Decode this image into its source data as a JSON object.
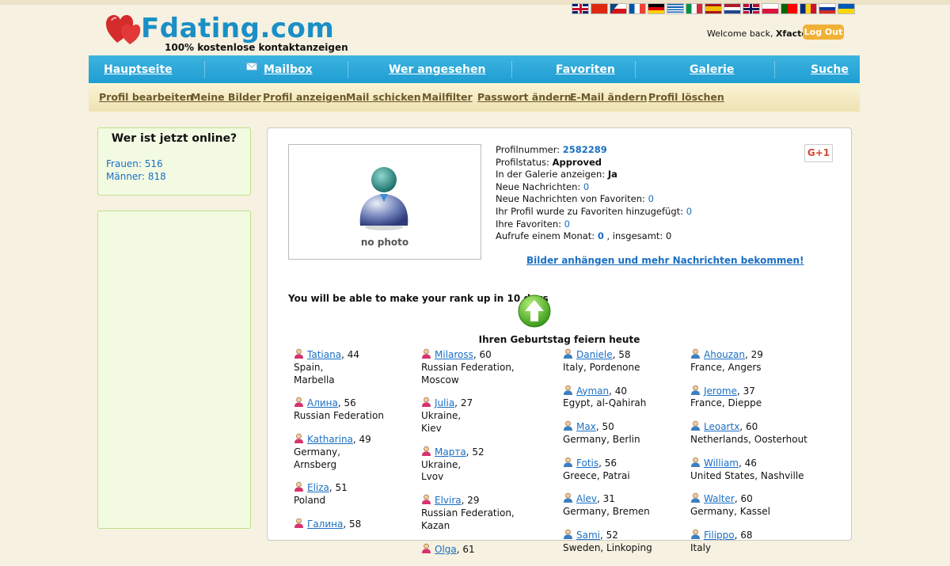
{
  "header": {
    "site_name": "Fdating.com",
    "tagline": "100% kostenlose kontaktanzeigen",
    "welcome_prefix": "Welcome back, ",
    "username": "Xfactor",
    "welcome_suffix": "!",
    "logout_label": "Log Out"
  },
  "languages": [
    "en",
    "zh",
    "cz",
    "fr",
    "de",
    "gr",
    "it",
    "es",
    "nl",
    "no",
    "pl",
    "pt",
    "ro",
    "ru",
    "ua"
  ],
  "main_nav": [
    "Hauptseite",
    "Mailbox",
    "Wer angesehen",
    "Favoriten",
    "Galerie",
    "Suche"
  ],
  "sub_nav": [
    "Profil bearbeiten",
    "Meine Bilder",
    "Profil anzeigen",
    "Mail schicken",
    "Mailfilter",
    "Passwort ändern",
    "E-Mail ändern",
    "Profil löschen"
  ],
  "online": {
    "title": "Wer ist jetzt online?",
    "women_label": "Frauen: 516",
    "men_label": "Männer: 818"
  },
  "profile": {
    "no_photo": "no photo",
    "number_label": "Profilnummer: ",
    "number": "2582289",
    "status_label": "Profilstatus: ",
    "status": "Approved",
    "gallery_label": "In der Galerie anzeigen: ",
    "gallery": "Ja",
    "new_messages_label": "Neue Nachrichten: ",
    "new_messages": "0",
    "fav_messages_label": "Neue Nachrichten von Favoriten: ",
    "fav_messages": "0",
    "added_label": "Ihr Profil wurde zu Favoriten hinzugefügt: ",
    "added": "0",
    "favorites_label": "Ihre Favoriten: ",
    "favorites": "0",
    "views_label": "Aufrufe einem Monat: ",
    "views_month": "0",
    "views_total_label": " , insgesamt: ",
    "views_total": "0",
    "gplus": "G+1",
    "attach_link": "Bilder anhängen und mehr Nachrichten bekommen!"
  },
  "rank_text": "You will be able to make your rank up in 10 days",
  "birthday_title": "Ihren Geburtstag feiern heute",
  "birthday_columns": [
    [
      {
        "name": "Tatiana",
        "age": "44",
        "gender": "female",
        "loc1": "Spain,",
        "loc2": "Marbella"
      },
      {
        "name": "Алина",
        "age": "56",
        "gender": "female",
        "loc1": "Russian Federation",
        "loc2": ""
      },
      {
        "name": "Katharina",
        "age": "49",
        "gender": "female",
        "loc1": "Germany,",
        "loc2": "Arnsberg"
      },
      {
        "name": "Eliza",
        "age": "51",
        "gender": "female",
        "loc1": "Poland",
        "loc2": ""
      },
      {
        "name": "Галина",
        "age": "58",
        "gender": "female",
        "loc1": "",
        "loc2": ""
      }
    ],
    [
      {
        "name": "Milaross",
        "age": "60",
        "gender": "female",
        "loc1": "Russian Federation,",
        "loc2": "Moscow"
      },
      {
        "name": "Julia",
        "age": "27",
        "gender": "female",
        "loc1": "Ukraine,",
        "loc2": "Kiev"
      },
      {
        "name": "Марта",
        "age": "52",
        "gender": "female",
        "loc1": "Ukraine,",
        "loc2": "Lvov"
      },
      {
        "name": "Elvira",
        "age": "29",
        "gender": "female",
        "loc1": "Russian Federation,",
        "loc2": "Kazan"
      },
      {
        "name": "Olga",
        "age": "61",
        "gender": "female",
        "loc1": "",
        "loc2": ""
      }
    ],
    [
      {
        "name": "Daniele",
        "age": "58",
        "gender": "male",
        "loc1": "Italy, Pordenone",
        "loc2": ""
      },
      {
        "name": "Ayman",
        "age": "40",
        "gender": "male",
        "loc1": "Egypt, al-Qahirah",
        "loc2": ""
      },
      {
        "name": "Max",
        "age": "50",
        "gender": "male",
        "loc1": "Germany, Berlin",
        "loc2": ""
      },
      {
        "name": "Fotis",
        "age": "56",
        "gender": "male",
        "loc1": "Greece, Patrai",
        "loc2": ""
      },
      {
        "name": "Alev",
        "age": "31",
        "gender": "male",
        "loc1": "Germany, Bremen",
        "loc2": ""
      },
      {
        "name": "Sami",
        "age": "52",
        "gender": "male",
        "loc1": "Sweden, Linkoping",
        "loc2": ""
      }
    ],
    [
      {
        "name": "Ahouzan",
        "age": "29",
        "gender": "male",
        "loc1": "France, Angers",
        "loc2": ""
      },
      {
        "name": "Jerome",
        "age": "37",
        "gender": "male",
        "loc1": "France, Dieppe",
        "loc2": ""
      },
      {
        "name": "Leoartx",
        "age": "60",
        "gender": "male",
        "loc1": "Netherlands, Oosterhout",
        "loc2": ""
      },
      {
        "name": "William",
        "age": "46",
        "gender": "male",
        "loc1": "United States, Nashville",
        "loc2": ""
      },
      {
        "name": "Walter",
        "age": "60",
        "gender": "male",
        "loc1": "Germany, Kassel",
        "loc2": ""
      },
      {
        "name": "Filippo",
        "age": "68",
        "gender": "male",
        "loc1": "Italy",
        "loc2": ""
      }
    ]
  ],
  "colors": {
    "nav_blue": "#1f9dd2",
    "brand_blue": "#1a8fc7",
    "logout_orange": "#f0b135",
    "link_blue": "#1a6fc4",
    "female_icon": "#d6336c",
    "male_icon": "#3b7fc0"
  }
}
